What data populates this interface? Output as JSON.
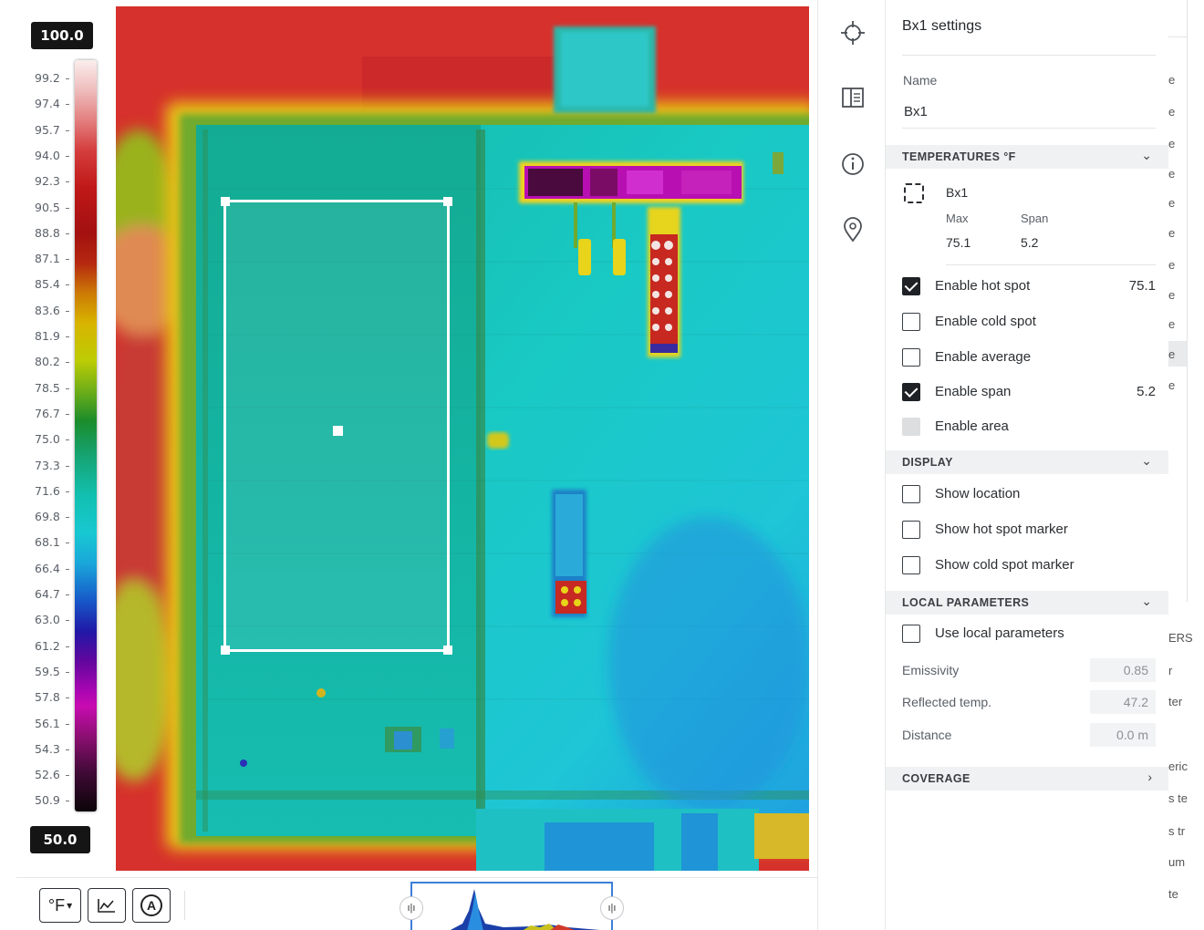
{
  "scale": {
    "max": "100.0",
    "min": "50.0",
    "ticks": [
      "99.2",
      "97.4",
      "95.7",
      "94.0",
      "92.3",
      "90.5",
      "88.8",
      "87.1",
      "85.4",
      "83.6",
      "81.9",
      "80.2",
      "78.5",
      "76.7",
      "75.0",
      "73.3",
      "71.6",
      "69.8",
      "68.1",
      "66.4",
      "64.7",
      "63.0",
      "61.2",
      "59.5",
      "57.8",
      "56.1",
      "54.3",
      "52.6",
      "50.9"
    ]
  },
  "toolbar": {
    "unit_label": "°F",
    "unit_caret": "▾",
    "graph_icon": "line-chart-icon",
    "auto_icon": "auto-icon",
    "auto_label": "A",
    "histogram_handle": "ı|ı"
  },
  "rail": {
    "icons": [
      "crosshair-icon",
      "panel-icon",
      "info-icon",
      "location-pin-icon"
    ]
  },
  "panel": {
    "title": "Bx1 settings",
    "name_label": "Name",
    "name_value": "Bx1",
    "temperatures": {
      "heading": "TEMPERATURES °F",
      "chevron": "⌄",
      "box_name": "Bx1",
      "max_label": "Max",
      "span_label": "Span",
      "max_value": "75.1",
      "span_value": "5.2",
      "options": [
        {
          "label": "Enable hot spot",
          "checked": true,
          "disabled": false,
          "value": "75.1"
        },
        {
          "label": "Enable cold spot",
          "checked": false,
          "disabled": false,
          "value": ""
        },
        {
          "label": "Enable average",
          "checked": false,
          "disabled": false,
          "value": ""
        },
        {
          "label": "Enable span",
          "checked": true,
          "disabled": false,
          "value": "5.2"
        },
        {
          "label": "Enable area",
          "checked": false,
          "disabled": true,
          "value": ""
        }
      ]
    },
    "display": {
      "heading": "DISPLAY",
      "chevron": "⌄",
      "options": [
        {
          "label": "Show location",
          "checked": false
        },
        {
          "label": "Show hot spot marker",
          "checked": false
        },
        {
          "label": "Show cold spot marker",
          "checked": false
        }
      ]
    },
    "local_parameters": {
      "heading": "LOCAL PARAMETERS",
      "chevron": "⌄",
      "use_label": "Use local parameters",
      "use_checked": false,
      "params": [
        {
          "label": "Emissivity",
          "value": "0.85"
        },
        {
          "label": "Reflected temp.",
          "value": "47.2"
        },
        {
          "label": "Distance",
          "value": "0.0 m"
        }
      ]
    },
    "coverage": {
      "heading": "COVERAGE",
      "chevron": "›"
    }
  },
  "right_strip": {
    "fragments": [
      "e",
      "e",
      "e",
      "e",
      "e",
      "e",
      "e",
      "e",
      "e",
      "e",
      "e",
      "ERS",
      "r",
      "ter",
      "eric",
      "s te",
      "s tr",
      "um",
      "te"
    ]
  },
  "colors": {
    "accent": "#3d7fd8",
    "dark": "#151515",
    "thermal_hot": "#d52f2a",
    "thermal_roof": "#1cc8c0"
  }
}
